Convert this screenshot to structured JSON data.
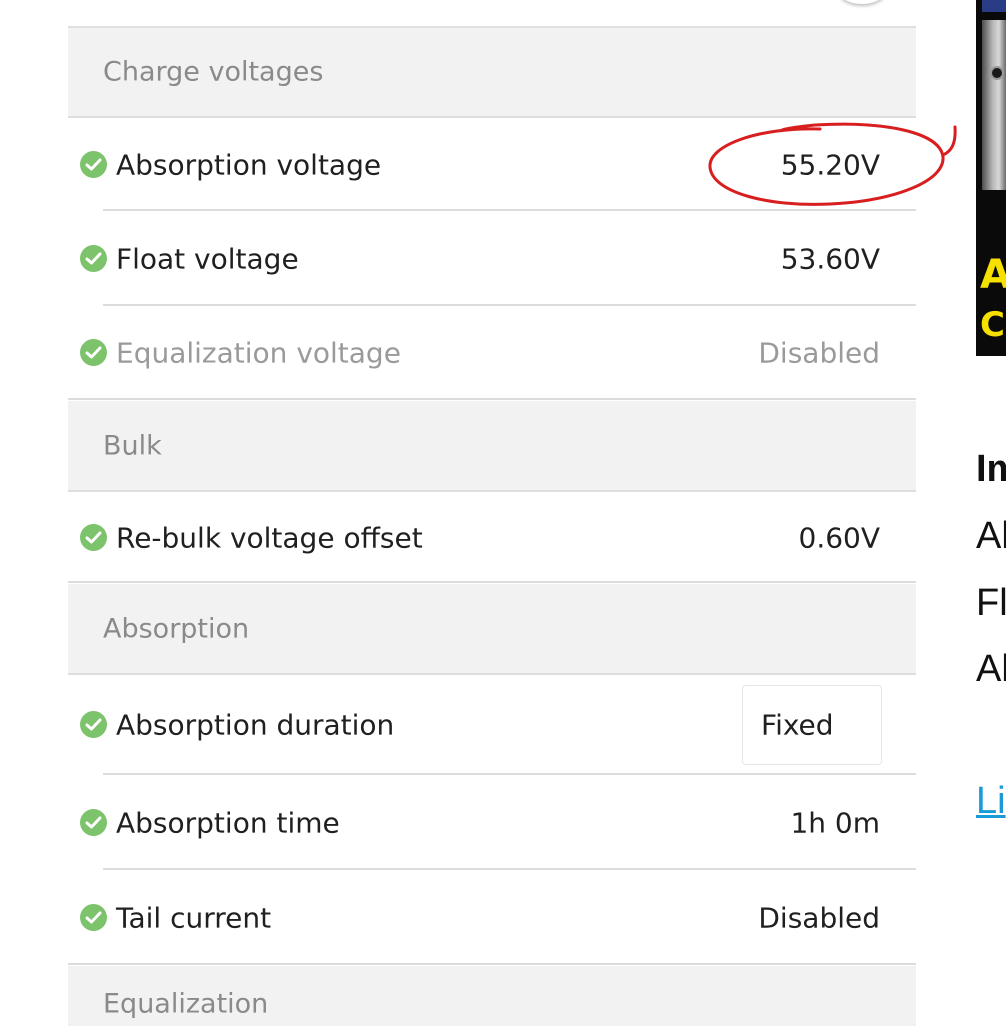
{
  "settings": {
    "sections": {
      "charge_voltages": "Charge voltages",
      "bulk": "Bulk",
      "absorption": "Absorption",
      "equalization": "Equalization"
    },
    "rows": {
      "absorption_voltage": {
        "label": "Absorption voltage",
        "value": "55.20V"
      },
      "float_voltage": {
        "label": "Float voltage",
        "value": "53.60V"
      },
      "equalization_voltage": {
        "label": "Equalization voltage",
        "value": "Disabled"
      },
      "rebulk_voltage_offset": {
        "label": "Re-bulk voltage offset",
        "value": "0.60V"
      },
      "absorption_duration": {
        "label": "Absorption duration",
        "value": "Fixed"
      },
      "absorption_time": {
        "label": "Absorption time",
        "value": "1h 0m"
      },
      "tail_current": {
        "label": "Tail current",
        "value": "Disabled"
      }
    }
  },
  "side_article": {
    "thumbnail_text_line1": "A",
    "thumbnail_text_line2": "C",
    "bold_line": "Im",
    "line1": "Al",
    "line2": "Fl",
    "line3": "Al",
    "link": "Li"
  },
  "colors": {
    "check_green": "#7cc36b",
    "section_bg": "#f2f2f2",
    "annotation_red": "#d81e1e",
    "link_blue": "#1a9ad6",
    "thumbnail_text_yellow": "#f5e000"
  },
  "icons": {
    "status": "check-circle-icon"
  }
}
